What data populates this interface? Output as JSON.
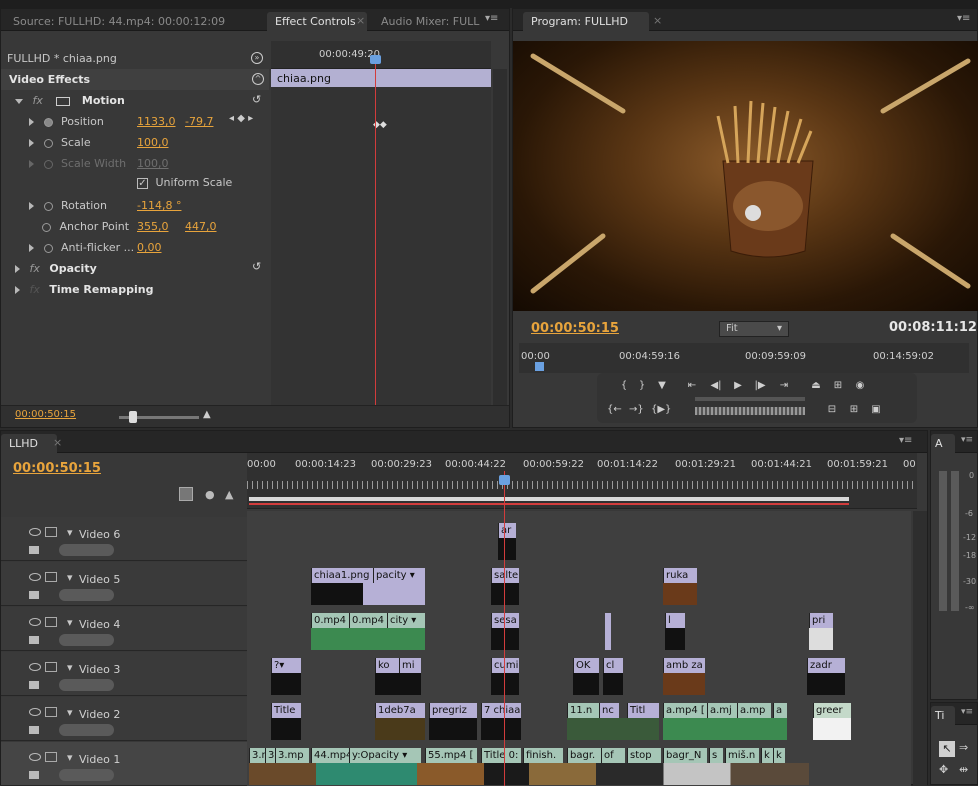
{
  "source_panel": {
    "tab_source": "Source: FULLHD: 44.mp4: 00:00:12:09",
    "tab_effect_controls": "Effect Controls",
    "tab_audio_mixer": "Audio Mixer: FULL",
    "sequence_label": "FULLHD * chiaa.png",
    "section_title": "Video Effects",
    "ruler_time": "00:00:49:20",
    "clip_name": "chiaa.png",
    "motion_label": "Motion",
    "position_label": "Position",
    "position_x": "1133,0",
    "position_y": "-79,7",
    "scale_label": "Scale",
    "scale_value": "100,0",
    "scale_width_label": "Scale Width",
    "scale_width_value": "100,0",
    "uniform_scale": "Uniform Scale",
    "rotation_label": "Rotation",
    "rotation_value": "-114,8 °",
    "anchor_label": "Anchor Point",
    "anchor_x": "355,0",
    "anchor_y": "447,0",
    "antiflicker_label": "Anti-flicker ...",
    "antiflicker_value": "0,00",
    "opacity_label": "Opacity",
    "time_remap_label": "Time Remapping",
    "current_time": "00:00:50:15"
  },
  "program_monitor": {
    "tab": "Program: FULLHD",
    "current_time": "00:00:50:15",
    "fit": "Fit",
    "duration": "00:08:11:12",
    "ruler": [
      "00:00",
      "00:04:59:16",
      "00:09:59:09",
      "00:14:59:02"
    ]
  },
  "timeline": {
    "tab": "LLHD",
    "current_time": "00:00:50:15",
    "ruler": [
      "00:00",
      "00:00:14:23",
      "00:00:29:23",
      "00:00:44:22",
      "00:00:59:22",
      "00:01:14:22",
      "00:01:29:21",
      "00:01:44:21",
      "00:01:59:21",
      "00"
    ],
    "tracks": [
      "Video 6",
      "Video 5",
      "Video 4",
      "Video 3",
      "Video 2",
      "Video 1"
    ],
    "clips_v6": [
      "ar"
    ],
    "clips_v5": [
      "chiaa1.png",
      "pacity ▾",
      "salte",
      "ruka"
    ],
    "clips_v4": [
      "0.mp4",
      "0.mp4",
      "city ▾",
      "sesa",
      "l",
      "pri"
    ],
    "clips_v3": [
      "?▾",
      "ko",
      "mi",
      "cumi",
      "OK",
      "cl",
      "amb za",
      "zadr"
    ],
    "clips_v2": [
      "Title",
      "1deb7a",
      "pregriz",
      "7 chiaa",
      "11.n",
      "nc",
      "Titl",
      "a.mp4 [",
      "a.mj",
      "a.mp",
      "a",
      "greer"
    ],
    "clips_v1": [
      "3.n",
      "3",
      "3.mp",
      "44.mp4",
      "y:Opacity ▾",
      "55.mp4 [",
      "Title 0:",
      "finish.",
      "bagr.",
      "of",
      "stop",
      "bagr_N",
      "s",
      "miš.n",
      "k",
      "k"
    ]
  },
  "audio_meters": {
    "tab": "A",
    "ticks": [
      "0",
      "-6",
      "-12",
      "-18",
      "-30",
      "-∞"
    ]
  },
  "tools_panel": {
    "tab": "Ti"
  }
}
